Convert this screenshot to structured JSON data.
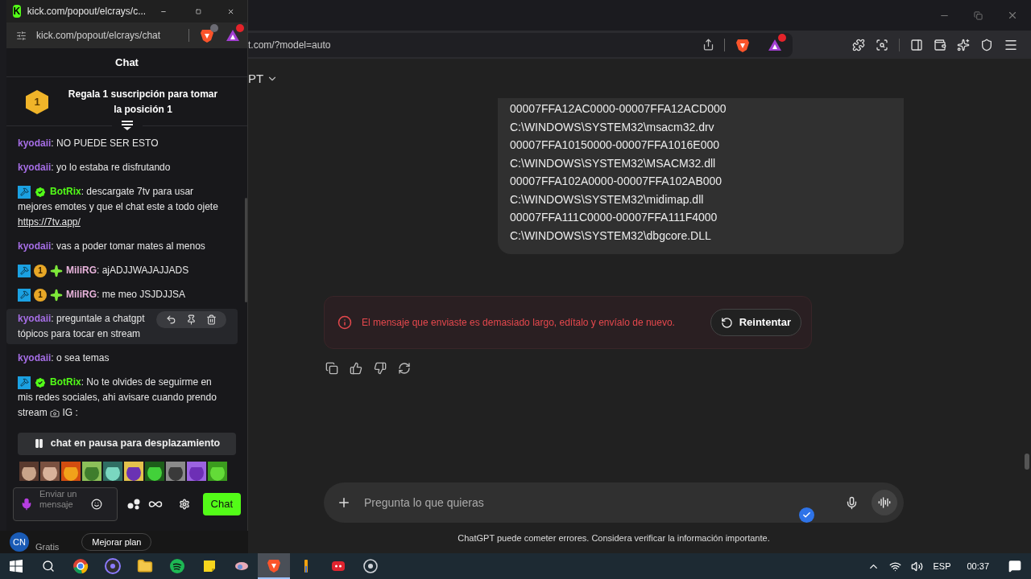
{
  "popup": {
    "logo": "K",
    "title": "kick.com/popout/elcrays/c...",
    "address": "kick.com/popout/elcrays/chat",
    "header": "Chat",
    "promo": {
      "rank": "1",
      "text": "Regala 1 suscripción para tomar la posición 1"
    },
    "messages": [
      {
        "user": "kyodaii",
        "color": "#a66ee6",
        "sep": ":",
        "text": "NO PUEDE SER ESTO",
        "highlighted": false
      },
      {
        "user": "kyodaii",
        "color": "#a66ee6",
        "sep": ":",
        "text": "yo lo estaba re disfrutando",
        "highlighted": false
      },
      {
        "user": "BotRix",
        "color": "#53fc18",
        "sep": ":",
        "badges": [
          {
            "kind": "mod"
          },
          {
            "kind": "verified"
          }
        ],
        "text": "descargate 7tv para usar mejores emotes y que el chat este a todo ojete",
        "link": "https://7tv.app/",
        "highlighted": false
      },
      {
        "user": "kyodaii",
        "color": "#a66ee6",
        "sep": ":",
        "text": "vas a poder tomar mates al menos",
        "highlighted": false
      },
      {
        "user": "MiliRG",
        "color": "#e9b4dc",
        "sep": ":",
        "badges": [
          {
            "kind": "mod"
          },
          {
            "kind": "sub",
            "label": "1"
          },
          {
            "kind": "gift"
          }
        ],
        "text": "ajADJJWAJAJJADS",
        "highlighted": false
      },
      {
        "user": "MiliRG",
        "color": "#e9b4dc",
        "sep": ":",
        "badges": [
          {
            "kind": "mod"
          },
          {
            "kind": "sub",
            "label": "1"
          },
          {
            "kind": "gift"
          }
        ],
        "text": "me meo JSJDJJSA",
        "highlighted": false
      },
      {
        "user": "kyodaii",
        "color": "#a66ee6",
        "sep": ":",
        "text": "preguntale a chatgpt tópicos para tocar en stream",
        "highlighted": true
      },
      {
        "user": "kyodaii",
        "color": "#a66ee6",
        "sep": ":",
        "text": "o sea temas",
        "highlighted": false
      },
      {
        "user": "BotRix",
        "color": "#53fc18",
        "sep": ":",
        "badges": [
          {
            "kind": "mod"
          },
          {
            "kind": "verified"
          }
        ],
        "text": "No te olvides de seguirme en mis redes sociales, ahi avisare cuando prendo stream",
        "emote": true,
        "suffix": "IG :",
        "highlighted": false
      }
    ],
    "paused_banner": "chat en pausa para desplazamiento",
    "input": {
      "placeholder": "Enviar un mensaje"
    },
    "send_button": "Chat"
  },
  "browser": {
    "url": "t.com/?model=auto"
  },
  "chatgpt": {
    "model": "PT",
    "code_lines": [
      "00007FFA12AC0000-00007FFA12ACD000",
      "C:\\WINDOWS\\SYSTEM32\\msacm32.drv",
      "00007FFA10150000-00007FFA1016E000",
      "C:\\WINDOWS\\SYSTEM32\\MSACM32.dll",
      "00007FFA102A0000-00007FFA102AB000",
      "C:\\WINDOWS\\SYSTEM32\\midimap.dll",
      "00007FFA111C0000-00007FFA111F4000",
      "C:\\WINDOWS\\SYSTEM32\\dbgcore.DLL"
    ],
    "error": {
      "text": "El mensaje que enviaste es demasiado largo, edítalo y envíalo de nuevo.",
      "button": "Reintentar"
    },
    "composer": {
      "placeholder": "Pregunta lo que quieras"
    },
    "disclaimer": "ChatGPT puede cometer errores. Considera verificar la información importante.",
    "account": {
      "avatar": "CN",
      "plan": "Gratis",
      "upgrade": "Mejorar plan"
    }
  },
  "taskbar": {
    "apps": [
      {
        "kind": "chrome",
        "selected": false
      },
      {
        "kind": "obs",
        "selected": false
      },
      {
        "kind": "folder",
        "selected": false
      },
      {
        "kind": "spotify",
        "selected": false
      },
      {
        "kind": "notes",
        "selected": false
      },
      {
        "kind": "game",
        "selected": false
      },
      {
        "kind": "brave",
        "selected": true
      },
      {
        "kind": "bar",
        "selected": false
      },
      {
        "kind": "discord",
        "selected": false
      },
      {
        "kind": "steam",
        "selected": false
      }
    ],
    "language": "ESP",
    "time": "00:37"
  }
}
